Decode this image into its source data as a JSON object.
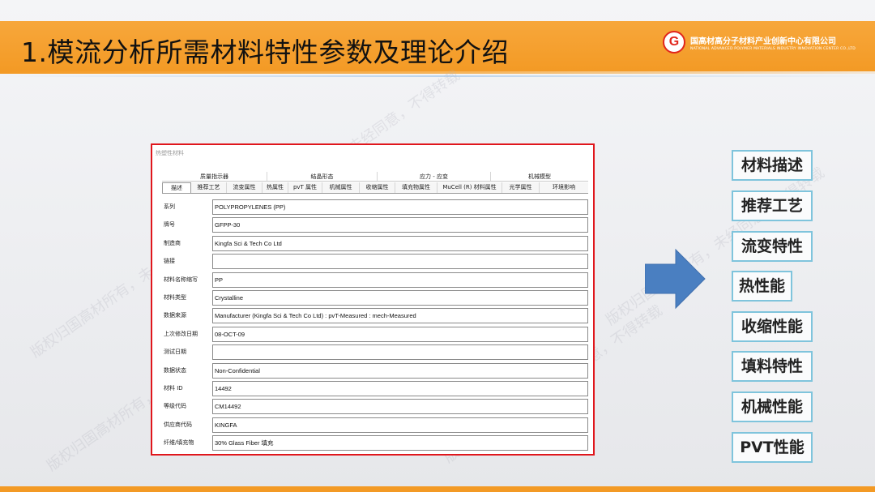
{
  "slide": {
    "title": "1.模流分析所需材料特性参数及理论介绍",
    "logo_letter": "G",
    "logo_cn": "国高材高分子材料产业创新中心有限公司",
    "logo_en": "NATIONAL ADVANCED POLYMER MATERIALS INDUSTRY INNOVATION CENTER CO.,LTD",
    "accent_color": "#f39a25",
    "watermark": "版权归国高材所有，未经同意，不得转载"
  },
  "dialog": {
    "title": "热塑性材料",
    "groups": [
      "质量指示器",
      "结晶形态",
      "应力 - 应变",
      "机械模型"
    ],
    "tabs": [
      "描述",
      "推荐工艺",
      "流变属性",
      "热属性",
      "pvT 属性",
      "机械属性",
      "收缩属性",
      "填充物属性",
      "MuCell (R) 材料属性",
      "光学属性",
      "环境影响"
    ],
    "active_tab": "描述",
    "fields": [
      {
        "label": "系列",
        "value": "POLYPROPYLENES (PP)"
      },
      {
        "label": "牌号",
        "value": "GFPP-30"
      },
      {
        "label": "制造商",
        "value": "Kingfa Sci & Tech Co Ltd"
      },
      {
        "label": "链接",
        "value": ""
      },
      {
        "label": "材料名称缩写",
        "value": "PP"
      },
      {
        "label": "材料类型",
        "value": "Crystalline"
      },
      {
        "label": "数据来源",
        "value": "Manufacturer (Kingfa Sci & Tech Co Ltd) : pvT-Measured : mech-Measured"
      },
      {
        "label": "上次修改日期",
        "value": "08-OCT-09"
      },
      {
        "label": "测试日期",
        "value": ""
      },
      {
        "label": "数据状态",
        "value": "Non-Confidential"
      },
      {
        "label": "材料 ID",
        "value": "14492"
      },
      {
        "label": "等级代码",
        "value": "CM14492"
      },
      {
        "label": "供应商代码",
        "value": "KINGFA"
      },
      {
        "label": "纤维/填充物",
        "value": "30% Glass Fiber 填充"
      }
    ]
  },
  "arrow": {
    "icon": "right-arrow-icon",
    "color": "#4a7fc1"
  },
  "right_items": [
    "材料描述",
    "推荐工艺",
    "流变特性",
    "热性能",
    "收缩性能",
    "填料特性",
    "机械性能",
    "PVT性能"
  ]
}
